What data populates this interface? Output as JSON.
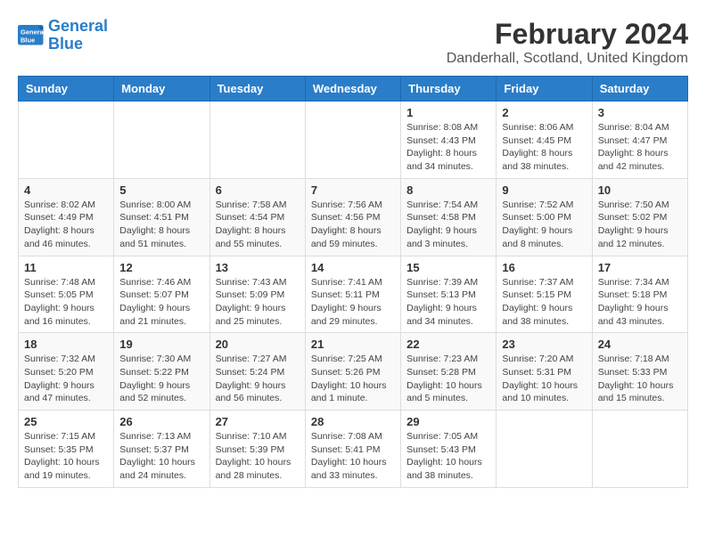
{
  "header": {
    "logo_line1": "General",
    "logo_line2": "Blue",
    "month_year": "February 2024",
    "location": "Danderhall, Scotland, United Kingdom"
  },
  "days_of_week": [
    "Sunday",
    "Monday",
    "Tuesday",
    "Wednesday",
    "Thursday",
    "Friday",
    "Saturday"
  ],
  "weeks": [
    [
      {
        "day": "",
        "info": ""
      },
      {
        "day": "",
        "info": ""
      },
      {
        "day": "",
        "info": ""
      },
      {
        "day": "",
        "info": ""
      },
      {
        "day": "1",
        "info": "Sunrise: 8:08 AM\nSunset: 4:43 PM\nDaylight: 8 hours\nand 34 minutes."
      },
      {
        "day": "2",
        "info": "Sunrise: 8:06 AM\nSunset: 4:45 PM\nDaylight: 8 hours\nand 38 minutes."
      },
      {
        "day": "3",
        "info": "Sunrise: 8:04 AM\nSunset: 4:47 PM\nDaylight: 8 hours\nand 42 minutes."
      }
    ],
    [
      {
        "day": "4",
        "info": "Sunrise: 8:02 AM\nSunset: 4:49 PM\nDaylight: 8 hours\nand 46 minutes."
      },
      {
        "day": "5",
        "info": "Sunrise: 8:00 AM\nSunset: 4:51 PM\nDaylight: 8 hours\nand 51 minutes."
      },
      {
        "day": "6",
        "info": "Sunrise: 7:58 AM\nSunset: 4:54 PM\nDaylight: 8 hours\nand 55 minutes."
      },
      {
        "day": "7",
        "info": "Sunrise: 7:56 AM\nSunset: 4:56 PM\nDaylight: 8 hours\nand 59 minutes."
      },
      {
        "day": "8",
        "info": "Sunrise: 7:54 AM\nSunset: 4:58 PM\nDaylight: 9 hours\nand 3 minutes."
      },
      {
        "day": "9",
        "info": "Sunrise: 7:52 AM\nSunset: 5:00 PM\nDaylight: 9 hours\nand 8 minutes."
      },
      {
        "day": "10",
        "info": "Sunrise: 7:50 AM\nSunset: 5:02 PM\nDaylight: 9 hours\nand 12 minutes."
      }
    ],
    [
      {
        "day": "11",
        "info": "Sunrise: 7:48 AM\nSunset: 5:05 PM\nDaylight: 9 hours\nand 16 minutes."
      },
      {
        "day": "12",
        "info": "Sunrise: 7:46 AM\nSunset: 5:07 PM\nDaylight: 9 hours\nand 21 minutes."
      },
      {
        "day": "13",
        "info": "Sunrise: 7:43 AM\nSunset: 5:09 PM\nDaylight: 9 hours\nand 25 minutes."
      },
      {
        "day": "14",
        "info": "Sunrise: 7:41 AM\nSunset: 5:11 PM\nDaylight: 9 hours\nand 29 minutes."
      },
      {
        "day": "15",
        "info": "Sunrise: 7:39 AM\nSunset: 5:13 PM\nDaylight: 9 hours\nand 34 minutes."
      },
      {
        "day": "16",
        "info": "Sunrise: 7:37 AM\nSunset: 5:15 PM\nDaylight: 9 hours\nand 38 minutes."
      },
      {
        "day": "17",
        "info": "Sunrise: 7:34 AM\nSunset: 5:18 PM\nDaylight: 9 hours\nand 43 minutes."
      }
    ],
    [
      {
        "day": "18",
        "info": "Sunrise: 7:32 AM\nSunset: 5:20 PM\nDaylight: 9 hours\nand 47 minutes."
      },
      {
        "day": "19",
        "info": "Sunrise: 7:30 AM\nSunset: 5:22 PM\nDaylight: 9 hours\nand 52 minutes."
      },
      {
        "day": "20",
        "info": "Sunrise: 7:27 AM\nSunset: 5:24 PM\nDaylight: 9 hours\nand 56 minutes."
      },
      {
        "day": "21",
        "info": "Sunrise: 7:25 AM\nSunset: 5:26 PM\nDaylight: 10 hours\nand 1 minute."
      },
      {
        "day": "22",
        "info": "Sunrise: 7:23 AM\nSunset: 5:28 PM\nDaylight: 10 hours\nand 5 minutes."
      },
      {
        "day": "23",
        "info": "Sunrise: 7:20 AM\nSunset: 5:31 PM\nDaylight: 10 hours\nand 10 minutes."
      },
      {
        "day": "24",
        "info": "Sunrise: 7:18 AM\nSunset: 5:33 PM\nDaylight: 10 hours\nand 15 minutes."
      }
    ],
    [
      {
        "day": "25",
        "info": "Sunrise: 7:15 AM\nSunset: 5:35 PM\nDaylight: 10 hours\nand 19 minutes."
      },
      {
        "day": "26",
        "info": "Sunrise: 7:13 AM\nSunset: 5:37 PM\nDaylight: 10 hours\nand 24 minutes."
      },
      {
        "day": "27",
        "info": "Sunrise: 7:10 AM\nSunset: 5:39 PM\nDaylight: 10 hours\nand 28 minutes."
      },
      {
        "day": "28",
        "info": "Sunrise: 7:08 AM\nSunset: 5:41 PM\nDaylight: 10 hours\nand 33 minutes."
      },
      {
        "day": "29",
        "info": "Sunrise: 7:05 AM\nSunset: 5:43 PM\nDaylight: 10 hours\nand 38 minutes."
      },
      {
        "day": "",
        "info": ""
      },
      {
        "day": "",
        "info": ""
      }
    ]
  ]
}
